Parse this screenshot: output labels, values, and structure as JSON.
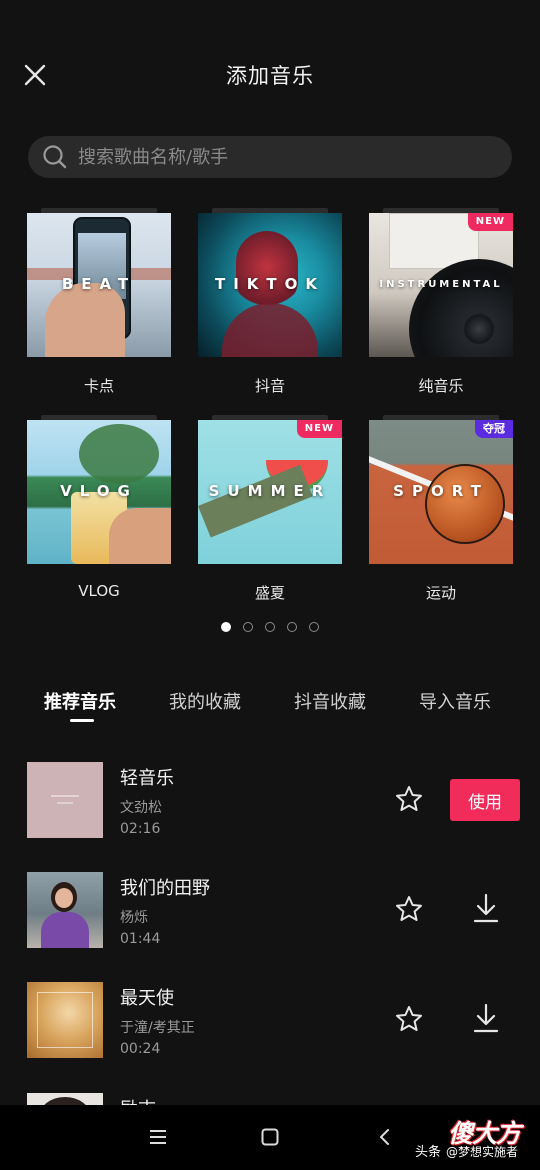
{
  "header": {
    "title": "添加音乐",
    "close_icon": "close-icon"
  },
  "search": {
    "placeholder": "搜索歌曲名称/歌手",
    "icon": "search-icon"
  },
  "categories": [
    {
      "name": "卡点",
      "cover_text": "BEAT",
      "badge": ""
    },
    {
      "name": "抖音",
      "cover_text": "TIKTOK",
      "badge": ""
    },
    {
      "name": "纯音乐",
      "cover_text": "INSTRUMENTAL",
      "badge": "NEW"
    },
    {
      "name": "VLOG",
      "cover_text": "VLOG",
      "badge": ""
    },
    {
      "name": "盛夏",
      "cover_text": "SUMMER",
      "badge": "NEW"
    },
    {
      "name": "运动",
      "cover_text": "SPORT",
      "badge": "夺冠"
    }
  ],
  "pager": {
    "count": 5,
    "active": 1
  },
  "tabs": [
    {
      "label": "推荐音乐",
      "active": true
    },
    {
      "label": "我的收藏",
      "active": false
    },
    {
      "label": "抖音收藏",
      "active": false
    },
    {
      "label": "导入音乐",
      "active": false
    }
  ],
  "songs": [
    {
      "title": "轻音乐",
      "artist": "文劲松",
      "duration": "02:16",
      "action": "使用",
      "favorite_icon": "star-outline-icon"
    },
    {
      "title": "我们的田野",
      "artist": "杨烁",
      "duration": "01:44",
      "action": "download",
      "favorite_icon": "star-outline-icon"
    },
    {
      "title": "最天使",
      "artist": "于潼/考其正",
      "duration": "00:24",
      "action": "download",
      "favorite_icon": "star-outline-icon"
    },
    {
      "title": "励志",
      "artist": "",
      "duration": "",
      "action": "",
      "favorite_icon": ""
    }
  ],
  "navbar": {
    "icons": [
      "menu-icon",
      "home-square-icon",
      "back-chevron-icon"
    ]
  },
  "watermark": {
    "source": "头条",
    "handle": "@梦想实施者",
    "logo": "傻大方"
  },
  "colors": {
    "background": "#121212",
    "accent": "#f12c5b",
    "badge_new": "#ee2a60",
    "badge_crown": "#5b2be0"
  }
}
